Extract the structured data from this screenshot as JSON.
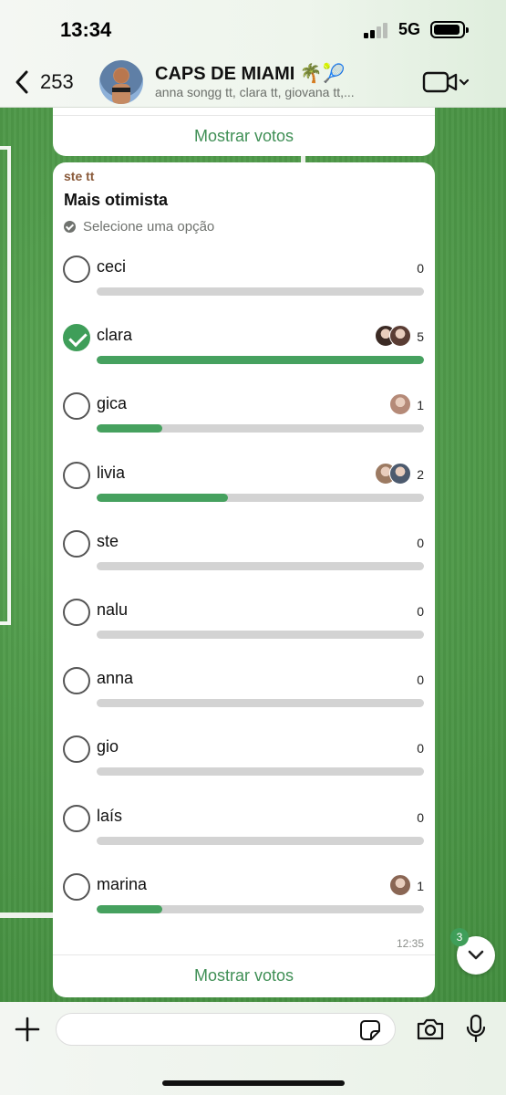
{
  "status_bar": {
    "time": "13:34",
    "network": "5G"
  },
  "header": {
    "back_count": "253",
    "title": "CAPS DE MIAMI",
    "title_emojis": "🌴🎾",
    "members": "anna songg tt, clara tt, giovana tt,..."
  },
  "previous_message": {
    "show_votes_label": "Mostrar votos"
  },
  "poll": {
    "sender": "ste tt",
    "question": "Mais otimista",
    "hint": "Selecione uma opção",
    "options": [
      {
        "label": "ceci",
        "count": "0",
        "fraction": 0,
        "checked": false,
        "voters": []
      },
      {
        "label": "clara",
        "count": "5",
        "fraction": 1.0,
        "checked": true,
        "voters": [
          "#3b2a24",
          "#5a3d34"
        ]
      },
      {
        "label": "gica",
        "count": "1",
        "fraction": 0.2,
        "checked": false,
        "voters": [
          "#b58a78"
        ]
      },
      {
        "label": "livia",
        "count": "2",
        "fraction": 0.4,
        "checked": false,
        "voters": [
          "#9c7a62",
          "#4c5a6e"
        ]
      },
      {
        "label": "ste",
        "count": "0",
        "fraction": 0,
        "checked": false,
        "voters": []
      },
      {
        "label": "nalu",
        "count": "0",
        "fraction": 0,
        "checked": false,
        "voters": []
      },
      {
        "label": "anna",
        "count": "0",
        "fraction": 0,
        "checked": false,
        "voters": []
      },
      {
        "label": "gio",
        "count": "0",
        "fraction": 0,
        "checked": false,
        "voters": []
      },
      {
        "label": "laís",
        "count": "0",
        "fraction": 0,
        "checked": false,
        "voters": []
      },
      {
        "label": "marina",
        "count": "1",
        "fraction": 0.2,
        "checked": false,
        "voters": [
          "#8a6654"
        ]
      }
    ],
    "time": "12:35",
    "show_votes_label": "Mostrar votos"
  },
  "unread_badge": "3",
  "composer": {
    "value": "",
    "placeholder": ""
  },
  "colors": {
    "accent": "#3f9e59",
    "bar_track": "#d3d3d3",
    "sender": "#8a5a3a"
  },
  "icons": [
    "chevron-left-icon",
    "video-call-icon",
    "chevron-down-icon",
    "plus-icon",
    "sticker-icon",
    "camera-icon",
    "microphone-icon"
  ]
}
